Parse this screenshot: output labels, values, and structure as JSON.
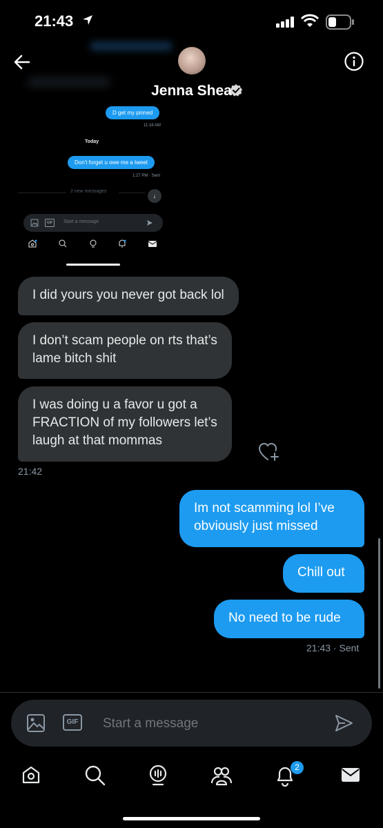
{
  "status_bar": {
    "time": "21:43"
  },
  "header": {
    "contact_name": "Jenna Shea",
    "verified": true
  },
  "embedded_screenshot": {
    "pinned_message": "D get my pinned",
    "pinned_time": "11:16 AM",
    "day_separator": "Today",
    "reminder_message": "Don't forget u owe me a tweet",
    "reminder_meta": "1:27 PM · Sent",
    "new_messages": "2 new messages",
    "input_placeholder": "Start a message"
  },
  "messages": {
    "received": [
      {
        "lines": [
          "I did yours you never got back lol"
        ]
      },
      {
        "lines": [
          "I don’t scam people on rts that’s",
          "lame bitch shit"
        ]
      },
      {
        "lines": [
          "I was doing u a favor u got a",
          "FRACTION of my followers let’s",
          "laugh at that mommas"
        ]
      }
    ],
    "received_time": "21:42",
    "sent": [
      {
        "lines": [
          "Im not scamming lol I’ve",
          "obviously just missed"
        ]
      },
      {
        "lines": [
          "Chill out"
        ]
      },
      {
        "lines": [
          "No need to be rude"
        ]
      }
    ],
    "sent_meta": "21:43 · Sent"
  },
  "composer": {
    "placeholder": "Start a message",
    "gif_label": "GIF"
  },
  "tab_bar": {
    "items": [
      "home-icon",
      "search-icon",
      "spaces-icon",
      "communities-icon",
      "notifications-icon",
      "messages-icon"
    ],
    "notifications_badge": "2"
  },
  "colors": {
    "background": "#000000",
    "sent_bubble": "#1d9bf0",
    "received_bubble": "#2f3336",
    "secondary_text": "#8b98a5"
  }
}
